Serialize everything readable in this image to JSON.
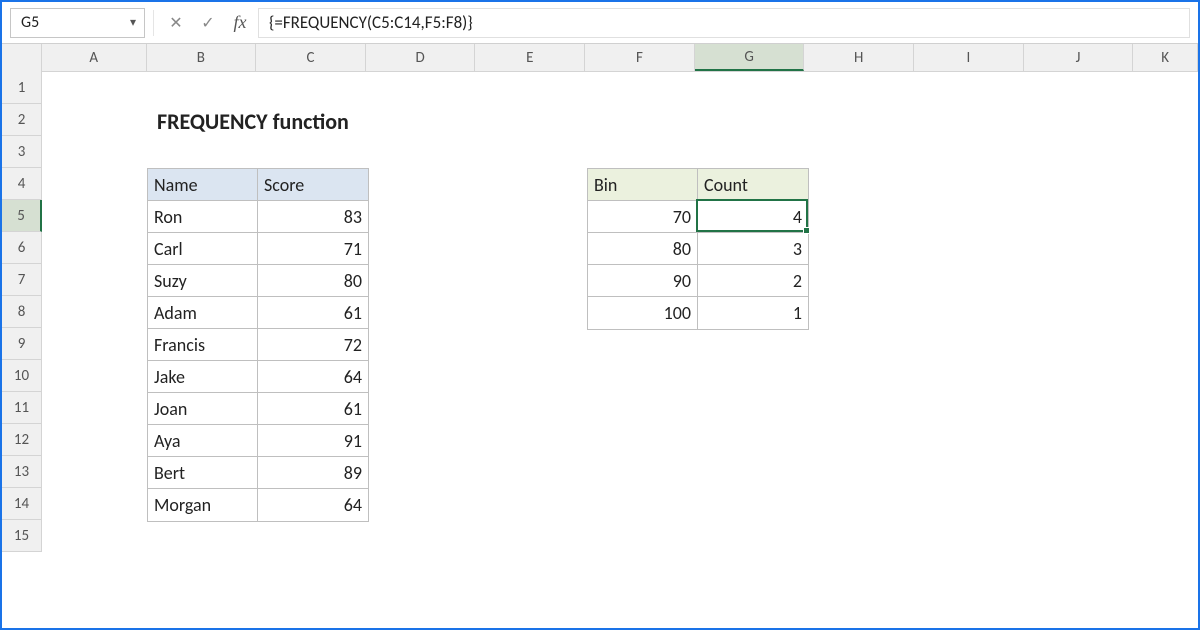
{
  "nameBox": "G5",
  "formula": "{=FREQUENCY(C5:C14,F5:F8)}",
  "columns": [
    "A",
    "B",
    "C",
    "D",
    "E",
    "F",
    "G",
    "H",
    "I",
    "J",
    "K"
  ],
  "rows": [
    "1",
    "2",
    "3",
    "4",
    "5",
    "6",
    "7",
    "8",
    "9",
    "10",
    "11",
    "12",
    "13",
    "14",
    "15"
  ],
  "title": "FREQUENCY function",
  "nameTable": {
    "headers": [
      "Name",
      "Score"
    ],
    "rows": [
      {
        "name": "Ron",
        "score": "83"
      },
      {
        "name": "Carl",
        "score": "71"
      },
      {
        "name": "Suzy",
        "score": "80"
      },
      {
        "name": "Adam",
        "score": "61"
      },
      {
        "name": "Francis",
        "score": "72"
      },
      {
        "name": "Jake",
        "score": "64"
      },
      {
        "name": "Joan",
        "score": "61"
      },
      {
        "name": "Aya",
        "score": "91"
      },
      {
        "name": "Bert",
        "score": "89"
      },
      {
        "name": "Morgan",
        "score": "64"
      }
    ]
  },
  "binTable": {
    "headers": [
      "Bin",
      "Count"
    ],
    "rows": [
      {
        "bin": "70",
        "count": "4"
      },
      {
        "bin": "80",
        "count": "3"
      },
      {
        "bin": "90",
        "count": "2"
      },
      {
        "bin": "100",
        "count": "1"
      }
    ]
  },
  "activeCell": {
    "col": "G",
    "row": "5"
  }
}
